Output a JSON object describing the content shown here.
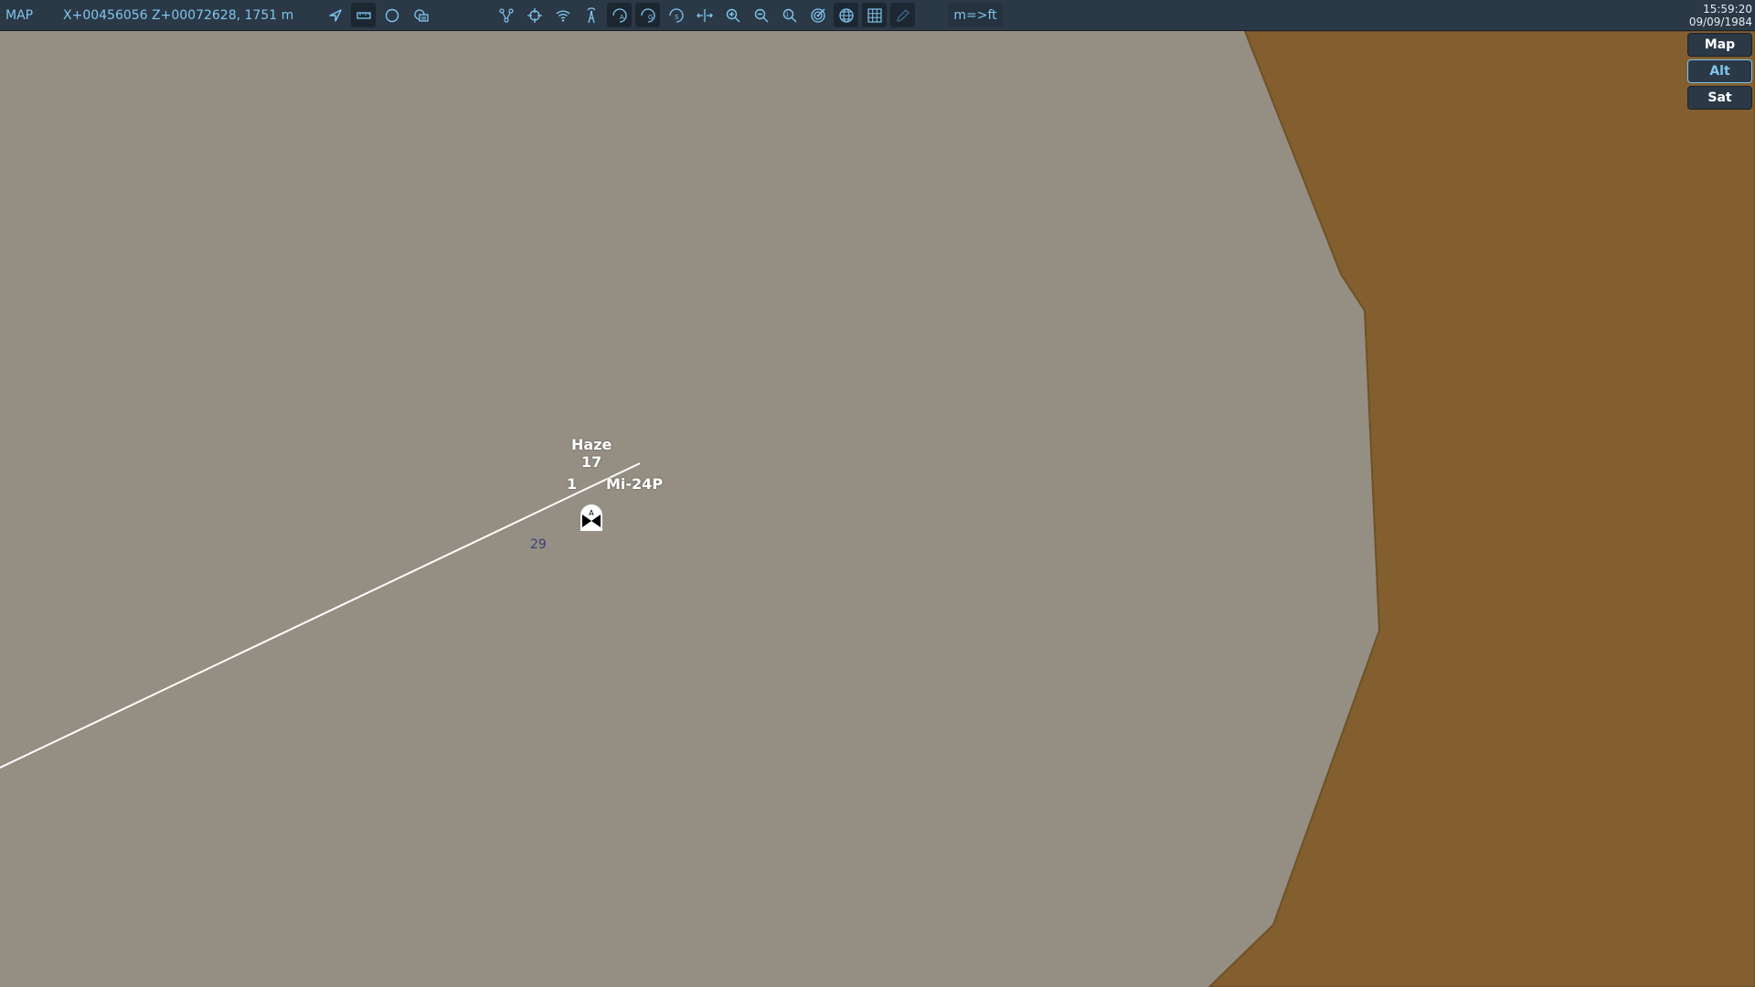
{
  "toolbar": {
    "mode_label": "MAP",
    "coordinates": "X+00456056 Z+00072628, 1751 m",
    "unit_toggle_label": "m=>ft",
    "tools": [
      "navigate-arrow-icon",
      "ruler-icon",
      "circle-icon",
      "layers-icon",
      "waypoint-path-icon",
      "crosshair-icon",
      "wifi-icon",
      "radio-tower-icon",
      "filter-a-icon",
      "filter-g-icon",
      "filter-s-icon",
      "expand-horizontal-icon",
      "zoom-in-icon",
      "zoom-out-icon",
      "zoom-reset-icon",
      "target-icon",
      "globe-icon",
      "grid-icon",
      "pencil-icon"
    ]
  },
  "clock": {
    "time": "15:59:20",
    "date": "09/09/1984"
  },
  "map_type": {
    "buttons": [
      "Map",
      "Alt",
      "Sat"
    ],
    "selected": "Alt"
  },
  "unit": {
    "name": "Haze",
    "number": "17",
    "group_index": "1",
    "type": "Mi-24P",
    "route_label": "29",
    "symbol_letter": "A"
  },
  "colors": {
    "toolbar_bg": "#2b3846",
    "accent": "#7fc6ee",
    "terrain_low": "#948f82",
    "terrain_high": "#835f2f",
    "route_line": "#ffffff"
  }
}
